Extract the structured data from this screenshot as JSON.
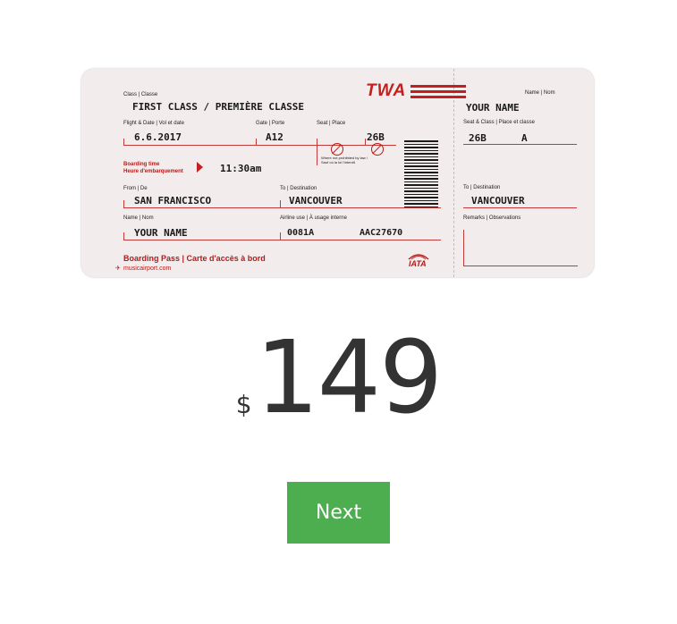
{
  "ticket": {
    "brand": "TWA",
    "class_label": "Class | Classe",
    "class_value": "FIRST CLASS / PREMIÈRE CLASSE",
    "name_label_top": "Name | Nom",
    "name_value_top": "YOUR NAME",
    "flight_date_label": "Flight & Date | Vol et date",
    "flight_date_value": "6.6.2017",
    "gate_label": "Gate | Porte",
    "gate_value": "A12",
    "seat_label": "Seat | Place",
    "seat_value": "26B",
    "no_smoking_note": "Where not prohibited by law / Sauf où la loi l'interdit",
    "seat_class_label": "Seat & Class | Place et classe",
    "seat_class_seat": "26B",
    "seat_class_class": "A",
    "boarding_time_label": "Boarding time",
    "boarding_time_label_fr": "Heure d'embarquement",
    "boarding_time_value": "11:30am",
    "from_label": "From | De",
    "from_value": "SAN FRANCISCO",
    "to_label": "To | Destination",
    "to_value": "VANCOUVER",
    "stub_to_label": "To | Destination",
    "stub_to_value": "VANCOUVER",
    "name_label": "Name | Nom",
    "name_value": "YOUR NAME",
    "airline_label": "Airline use | À usage interne",
    "airline_code1": "0081A",
    "airline_code2": "AAC27670",
    "remarks_label": "Remarks | Observations",
    "boarding_pass": "Boarding Pass | Carte d'accès à bord",
    "website": "musicairport.com",
    "iata": "IATA"
  },
  "price": {
    "currency": "$",
    "amount": "149"
  },
  "next_label": "Next"
}
